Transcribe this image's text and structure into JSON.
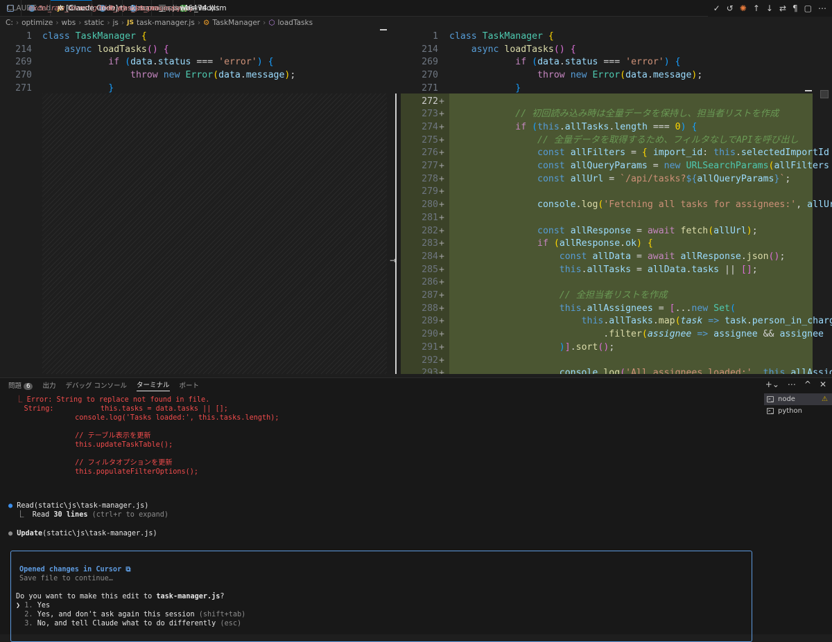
{
  "tabs": [
    {
      "icon": "markdown-icon",
      "label": "CLAUDE.md",
      "deco": "",
      "italic": false,
      "active": false
    },
    {
      "icon": "python-icon",
      "label": "excel_raw_investigation.py",
      "deco": "5",
      "italic": true,
      "active": false
    },
    {
      "icon": "javascript-icon",
      "label": "✲ [Claude Code] task-manager.js (4647dd)",
      "deco": "",
      "italic": false,
      "active": true
    },
    {
      "icon": "python-icon",
      "label": "test_wbs_processor.py",
      "deco": "D",
      "italic": false,
      "active": false
    },
    {
      "icon": "python-icon",
      "label": "wbs_processor.py",
      "deco": "1",
      "italic": false,
      "active": false
    },
    {
      "icon": "text-icon",
      "label": "requirements.txt",
      "deco": "",
      "italic": false,
      "active": false
    },
    {
      "icon": "excel-icon",
      "label": "wbs_v4.xlsm",
      "deco": "",
      "italic": false,
      "active": false
    }
  ],
  "js_badge": "JS",
  "tab_close_glyph": "✕",
  "tab_split_glyph": "⧉",
  "tab_actions": [
    "✓",
    "↺",
    "✺",
    "↑",
    "↓",
    "⇄",
    "¶",
    "▢",
    "⋯"
  ],
  "breadcrumb": [
    "C:",
    "optimize",
    "wbs",
    "static",
    "js",
    "task-manager.js",
    "TaskManager",
    "loadTasks"
  ],
  "breadcrumb_sep": "›",
  "colors": {
    "accent": "#0078d4",
    "added_bg": "#4b5632",
    "error": "#f14c4c"
  },
  "left_lines": [
    {
      "n": "1",
      "segs": [
        [
          "k",
          "class "
        ],
        [
          "c",
          "TaskManager "
        ],
        [
          "b1",
          "{"
        ]
      ]
    },
    {
      "n": "214",
      "segs": [
        [
          "p",
          "    "
        ],
        [
          "k",
          "async "
        ],
        [
          "f",
          "loadTasks"
        ],
        [
          "b2",
          "() "
        ],
        [
          "b2",
          "{"
        ]
      ]
    },
    {
      "n": "269",
      "segs": [
        [
          "p",
          "            "
        ],
        [
          "kw",
          "if "
        ],
        [
          "b3",
          "("
        ],
        [
          "v",
          "data"
        ],
        [
          "p",
          "."
        ],
        [
          "v",
          "status"
        ],
        [
          "p",
          " === "
        ],
        [
          "s",
          "'error'"
        ],
        [
          "b3",
          ") "
        ],
        [
          "b3",
          "{"
        ]
      ]
    },
    {
      "n": "270",
      "segs": [
        [
          "p",
          "                "
        ],
        [
          "kw",
          "throw "
        ],
        [
          "k",
          "new "
        ],
        [
          "c",
          "Error"
        ],
        [
          "b1",
          "("
        ],
        [
          "v",
          "data"
        ],
        [
          "p",
          "."
        ],
        [
          "v",
          "message"
        ],
        [
          "b1",
          ")"
        ],
        [
          "p",
          ";"
        ]
      ]
    },
    {
      "n": "271",
      "segs": [
        [
          "p",
          "            "
        ],
        [
          "b3",
          "}"
        ]
      ]
    }
  ],
  "right_lines": [
    {
      "n": "1",
      "m": "",
      "segs": [
        [
          "k",
          "class "
        ],
        [
          "c",
          "TaskManager "
        ],
        [
          "b1",
          "{"
        ]
      ]
    },
    {
      "n": "214",
      "m": "",
      "segs": [
        [
          "p",
          "    "
        ],
        [
          "k",
          "async "
        ],
        [
          "f",
          "loadTasks"
        ],
        [
          "b2",
          "() "
        ],
        [
          "b2",
          "{"
        ]
      ]
    },
    {
      "n": "269",
      "m": "",
      "segs": [
        [
          "p",
          "            "
        ],
        [
          "kw",
          "if "
        ],
        [
          "b3",
          "("
        ],
        [
          "v",
          "data"
        ],
        [
          "p",
          "."
        ],
        [
          "v",
          "status"
        ],
        [
          "p",
          " === "
        ],
        [
          "s",
          "'error'"
        ],
        [
          "b3",
          ") "
        ],
        [
          "b3",
          "{"
        ]
      ]
    },
    {
      "n": "270",
      "m": "",
      "segs": [
        [
          "p",
          "                "
        ],
        [
          "kw",
          "throw "
        ],
        [
          "k",
          "new "
        ],
        [
          "c",
          "Error"
        ],
        [
          "b1",
          "("
        ],
        [
          "v",
          "data"
        ],
        [
          "p",
          "."
        ],
        [
          "v",
          "message"
        ],
        [
          "b1",
          ")"
        ],
        [
          "p",
          ";"
        ]
      ]
    },
    {
      "n": "271",
      "m": "",
      "segs": [
        [
          "p",
          "            "
        ],
        [
          "b3",
          "}"
        ]
      ]
    },
    {
      "n": "272",
      "m": "+",
      "cur": true,
      "segs": []
    },
    {
      "n": "273",
      "m": "+",
      "segs": [
        [
          "p",
          "            "
        ],
        [
          "cm",
          "// 初回読み込み時は全量データを保持し、担当者リストを作成"
        ]
      ]
    },
    {
      "n": "274",
      "m": "+",
      "segs": [
        [
          "p",
          "            "
        ],
        [
          "kw",
          "if "
        ],
        [
          "b3",
          "("
        ],
        [
          "k",
          "this"
        ],
        [
          "p",
          "."
        ],
        [
          "v",
          "allTasks"
        ],
        [
          "p",
          "."
        ],
        [
          "v",
          "length"
        ],
        [
          "p",
          " === "
        ],
        [
          "b1",
          "0"
        ],
        [
          "b3",
          ") "
        ],
        [
          "b3",
          "{"
        ]
      ]
    },
    {
      "n": "275",
      "m": "+",
      "segs": [
        [
          "p",
          "                "
        ],
        [
          "cm",
          "// 全量データを取得するため、フィルタなしでAPIを呼び出し"
        ]
      ]
    },
    {
      "n": "276",
      "m": "+",
      "segs": [
        [
          "p",
          "                "
        ],
        [
          "k",
          "const "
        ],
        [
          "v",
          "allFilters"
        ],
        [
          "p",
          " = "
        ],
        [
          "b1",
          "{ "
        ],
        [
          "v",
          "import_id"
        ],
        [
          "p",
          ": "
        ],
        [
          "k",
          "this"
        ],
        [
          "p",
          "."
        ],
        [
          "v",
          "selectedImportId"
        ]
      ]
    },
    {
      "n": "277",
      "m": "+",
      "segs": [
        [
          "p",
          "                "
        ],
        [
          "k",
          "const "
        ],
        [
          "v",
          "allQueryParams"
        ],
        [
          "p",
          " = "
        ],
        [
          "k",
          "new "
        ],
        [
          "c",
          "URLSearchParams"
        ],
        [
          "b1",
          "("
        ],
        [
          "v",
          "allFilters"
        ]
      ]
    },
    {
      "n": "278",
      "m": "+",
      "segs": [
        [
          "p",
          "                "
        ],
        [
          "k",
          "const "
        ],
        [
          "v",
          "allUrl"
        ],
        [
          "p",
          " = "
        ],
        [
          "s",
          "`/api/tasks?"
        ],
        [
          "k",
          "${"
        ],
        [
          "v",
          "allQueryParams"
        ],
        [
          "k",
          "}"
        ],
        [
          "s",
          "`"
        ],
        [
          "p",
          ";"
        ]
      ]
    },
    {
      "n": "279",
      "m": "+",
      "segs": []
    },
    {
      "n": "280",
      "m": "+",
      "segs": [
        [
          "p",
          "                "
        ],
        [
          "v",
          "console"
        ],
        [
          "p",
          "."
        ],
        [
          "f",
          "log"
        ],
        [
          "b1",
          "("
        ],
        [
          "s",
          "'Fetching all tasks for assignees:'"
        ],
        [
          "p",
          ", "
        ],
        [
          "v",
          "allUrl"
        ]
      ]
    },
    {
      "n": "281",
      "m": "+",
      "segs": []
    },
    {
      "n": "282",
      "m": "+",
      "segs": [
        [
          "p",
          "                "
        ],
        [
          "k",
          "const "
        ],
        [
          "v",
          "allResponse"
        ],
        [
          "p",
          " = "
        ],
        [
          "kw",
          "await "
        ],
        [
          "f",
          "fetch"
        ],
        [
          "b1",
          "("
        ],
        [
          "v",
          "allUrl"
        ],
        [
          "b1",
          ")"
        ],
        [
          "p",
          ";"
        ]
      ]
    },
    {
      "n": "283",
      "m": "+",
      "segs": [
        [
          "p",
          "                "
        ],
        [
          "kw",
          "if "
        ],
        [
          "b1",
          "("
        ],
        [
          "v",
          "allResponse"
        ],
        [
          "p",
          "."
        ],
        [
          "v",
          "ok"
        ],
        [
          "b1",
          ") "
        ],
        [
          "b1",
          "{"
        ]
      ]
    },
    {
      "n": "284",
      "m": "+",
      "segs": [
        [
          "p",
          "                    "
        ],
        [
          "k",
          "const "
        ],
        [
          "v",
          "allData"
        ],
        [
          "p",
          " = "
        ],
        [
          "kw",
          "await "
        ],
        [
          "v",
          "allResponse"
        ],
        [
          "p",
          "."
        ],
        [
          "f",
          "json"
        ],
        [
          "b2",
          "()"
        ],
        [
          "p",
          ";"
        ]
      ]
    },
    {
      "n": "285",
      "m": "+",
      "segs": [
        [
          "p",
          "                    "
        ],
        [
          "k",
          "this"
        ],
        [
          "p",
          "."
        ],
        [
          "v",
          "allTasks"
        ],
        [
          "p",
          " = "
        ],
        [
          "v",
          "allData"
        ],
        [
          "p",
          "."
        ],
        [
          "v",
          "tasks"
        ],
        [
          "p",
          " || "
        ],
        [
          "b2",
          "[]"
        ],
        [
          "p",
          ";"
        ]
      ]
    },
    {
      "n": "286",
      "m": "+",
      "segs": []
    },
    {
      "n": "287",
      "m": "+",
      "segs": [
        [
          "p",
          "                    "
        ],
        [
          "cm",
          "// 全担当者リストを作成"
        ]
      ]
    },
    {
      "n": "288",
      "m": "+",
      "segs": [
        [
          "p",
          "                    "
        ],
        [
          "k",
          "this"
        ],
        [
          "p",
          "."
        ],
        [
          "v",
          "allAssignees"
        ],
        [
          "p",
          " = "
        ],
        [
          "b2",
          "["
        ],
        [
          "p",
          "..."
        ],
        [
          "k",
          "new "
        ],
        [
          "c",
          "Set"
        ],
        [
          "b3",
          "("
        ]
      ]
    },
    {
      "n": "289",
      "m": "+",
      "segs": [
        [
          "p",
          "                        "
        ],
        [
          "k",
          "this"
        ],
        [
          "p",
          "."
        ],
        [
          "v",
          "allTasks"
        ],
        [
          "p",
          "."
        ],
        [
          "f",
          "map"
        ],
        [
          "b1",
          "("
        ],
        [
          "v it",
          "task"
        ],
        [
          "k",
          " => "
        ],
        [
          "v",
          "task"
        ],
        [
          "p",
          "."
        ],
        [
          "v",
          "person_in_charge"
        ]
      ]
    },
    {
      "n": "290",
      "m": "+",
      "segs": [
        [
          "p",
          "                            ."
        ],
        [
          "f",
          "filter"
        ],
        [
          "b1",
          "("
        ],
        [
          "v it",
          "assignee"
        ],
        [
          "k",
          " => "
        ],
        [
          "v",
          "assignee"
        ],
        [
          "p",
          " && "
        ],
        [
          "v",
          "assignee"
        ]
      ]
    },
    {
      "n": "291",
      "m": "+",
      "segs": [
        [
          "p",
          "                    "
        ],
        [
          "b3",
          ")"
        ],
        [
          "b2",
          "]"
        ],
        [
          "p",
          "."
        ],
        [
          "f",
          "sort"
        ],
        [
          "b2",
          "()"
        ],
        [
          "p",
          ";"
        ]
      ]
    },
    {
      "n": "292",
      "m": "+",
      "segs": []
    },
    {
      "n": "293",
      "m": "+",
      "segs": [
        [
          "p",
          "                    "
        ],
        [
          "v",
          "console"
        ],
        [
          "p",
          "."
        ],
        [
          "f",
          "log"
        ],
        [
          "b2",
          "("
        ],
        [
          "s",
          "'All assignees loaded:'"
        ],
        [
          "p",
          ", "
        ],
        [
          "k",
          "this"
        ],
        [
          "p",
          "."
        ],
        [
          "v",
          "allAssignees"
        ]
      ]
    }
  ],
  "panel_tabs": [
    {
      "label": "問題",
      "badge": "6",
      "active": false
    },
    {
      "label": "出力",
      "badge": "",
      "active": false
    },
    {
      "label": "デバッグ コンソール",
      "badge": "",
      "active": false
    },
    {
      "label": "ターミナル",
      "badge": "",
      "active": true
    },
    {
      "label": "ポート",
      "badge": "",
      "active": false
    }
  ],
  "panel_actions": [
    "+⌄",
    "⋯",
    "^",
    "✕"
  ],
  "terminal": {
    "err_lines": [
      "  ⎿ Error: String to replace not found in file.",
      "    String:           this.tasks = data.tasks || [];",
      "                console.log('Tasks loaded:', this.tasks.length);",
      "",
      "                // テーブル表示を更新",
      "                this.updateTaskTable();",
      "",
      "                // フィルタオプションを更新",
      "                this.populateFilterOptions();"
    ],
    "read_call": "Read",
    "read_args": "(static\\js\\task-manager.js)",
    "read_result": "  ⎿  Read ",
    "read_count": "30 lines",
    "read_hint": " (ctrl+r to expand)",
    "update_call": "Update",
    "update_args": "(static\\js\\task-manager.js)",
    "bullet": "●",
    "prompt": {
      "opened": "Opened changes in Cursor ⧉",
      "save_hint": "Save file to continue…",
      "question_prefix": "Do you want to make this edit to ",
      "question_file": "task-manager.js",
      "question_suffix": "?",
      "options": [
        {
          "marker": "❯",
          "num": "1.",
          "text": "Yes",
          "hint": ""
        },
        {
          "marker": " ",
          "num": "2.",
          "text": "Yes, and don't ask again this session ",
          "hint": "(shift+tab)"
        },
        {
          "marker": " ",
          "num": "3.",
          "text": "No, and tell Claude what to do differently ",
          "hint": "(esc)"
        }
      ]
    }
  },
  "terminal_list": [
    {
      "label": "node",
      "warn": "⚠",
      "selected": true
    },
    {
      "label": "python",
      "warn": "",
      "selected": false
    }
  ]
}
